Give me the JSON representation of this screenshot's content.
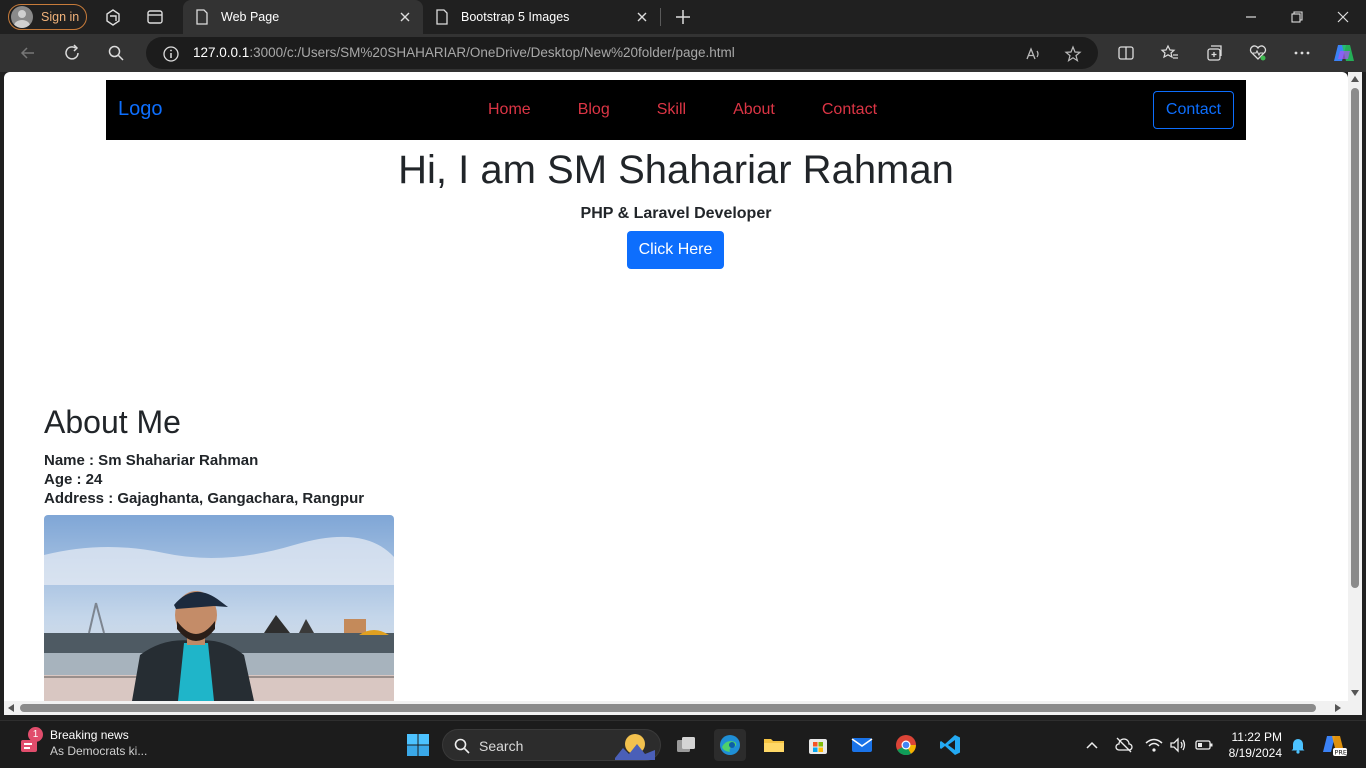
{
  "browser": {
    "signin_label": "Sign in",
    "tabs": [
      {
        "title": "Web Page",
        "active": true
      },
      {
        "title": "Bootstrap 5 Images",
        "active": false
      }
    ],
    "url_host": "127.0.0.1",
    "url_rest": ":3000/c:/Users/SM%20SHAHARIAR/OneDrive/Desktop/New%20folder/page.html"
  },
  "page": {
    "navbar": {
      "brand": "Logo",
      "links": [
        "Home",
        "Blog",
        "Skill",
        "About",
        "Contact"
      ],
      "contact_button": "Contact"
    },
    "hero": {
      "title": "Hi, I am SM Shahariar Rahman",
      "subtitle": "PHP & Laravel Developer",
      "button": "Click Here"
    },
    "about": {
      "title": "About Me",
      "name": "Name : Sm Shahariar Rahman",
      "age": "Age : 24",
      "address": "Address : Gajaghanta, Gangachara, Rangpur"
    },
    "colors": {
      "primary": "#0d6efd",
      "danger": "#dc3545",
      "navbar_bg": "#000000"
    }
  },
  "taskbar": {
    "news_title": "Breaking news",
    "news_sub": "As Democrats ki...",
    "news_badge": "1",
    "search_label": "Search",
    "time": "11:22 PM",
    "date": "8/19/2024"
  }
}
